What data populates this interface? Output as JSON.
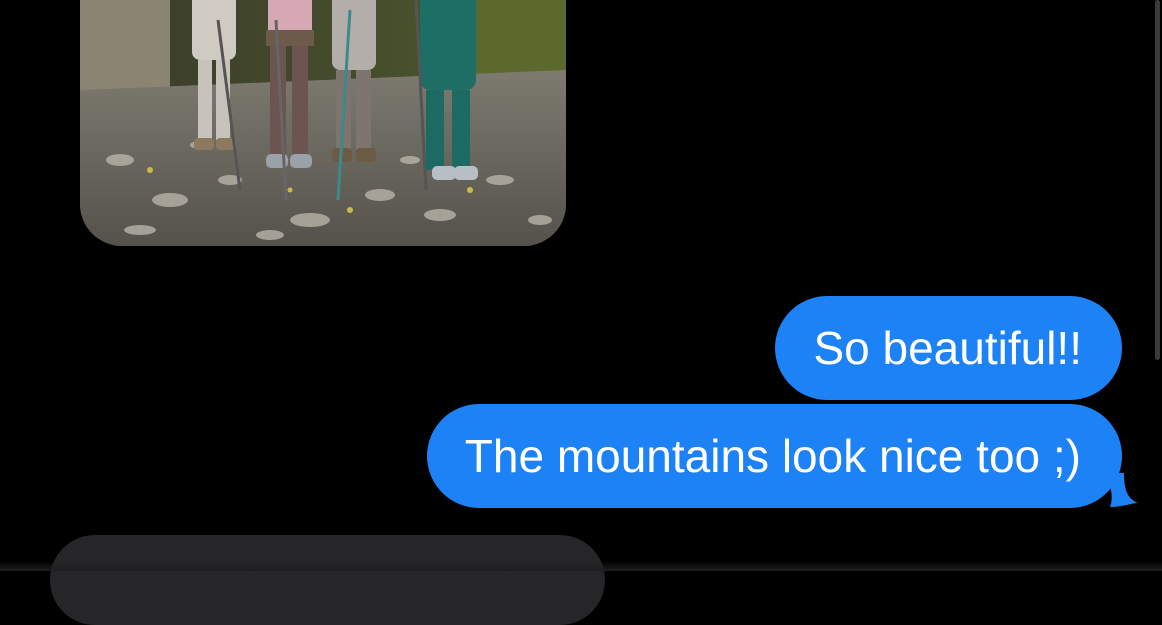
{
  "colors": {
    "background": "#000000",
    "outgoing_bubble": "#1D82F5",
    "outgoing_text": "#FFFFFF",
    "incoming_bubble": "#262628"
  },
  "messages": [
    {
      "id": "photo",
      "direction": "incoming",
      "kind": "image"
    },
    {
      "id": "m1",
      "direction": "outgoing",
      "text": "So beautiful!!"
    },
    {
      "id": "m2",
      "direction": "outgoing",
      "text": "The mountains look nice too ;)"
    },
    {
      "id": "m3",
      "direction": "incoming",
      "kind": "text",
      "text": ""
    }
  ]
}
